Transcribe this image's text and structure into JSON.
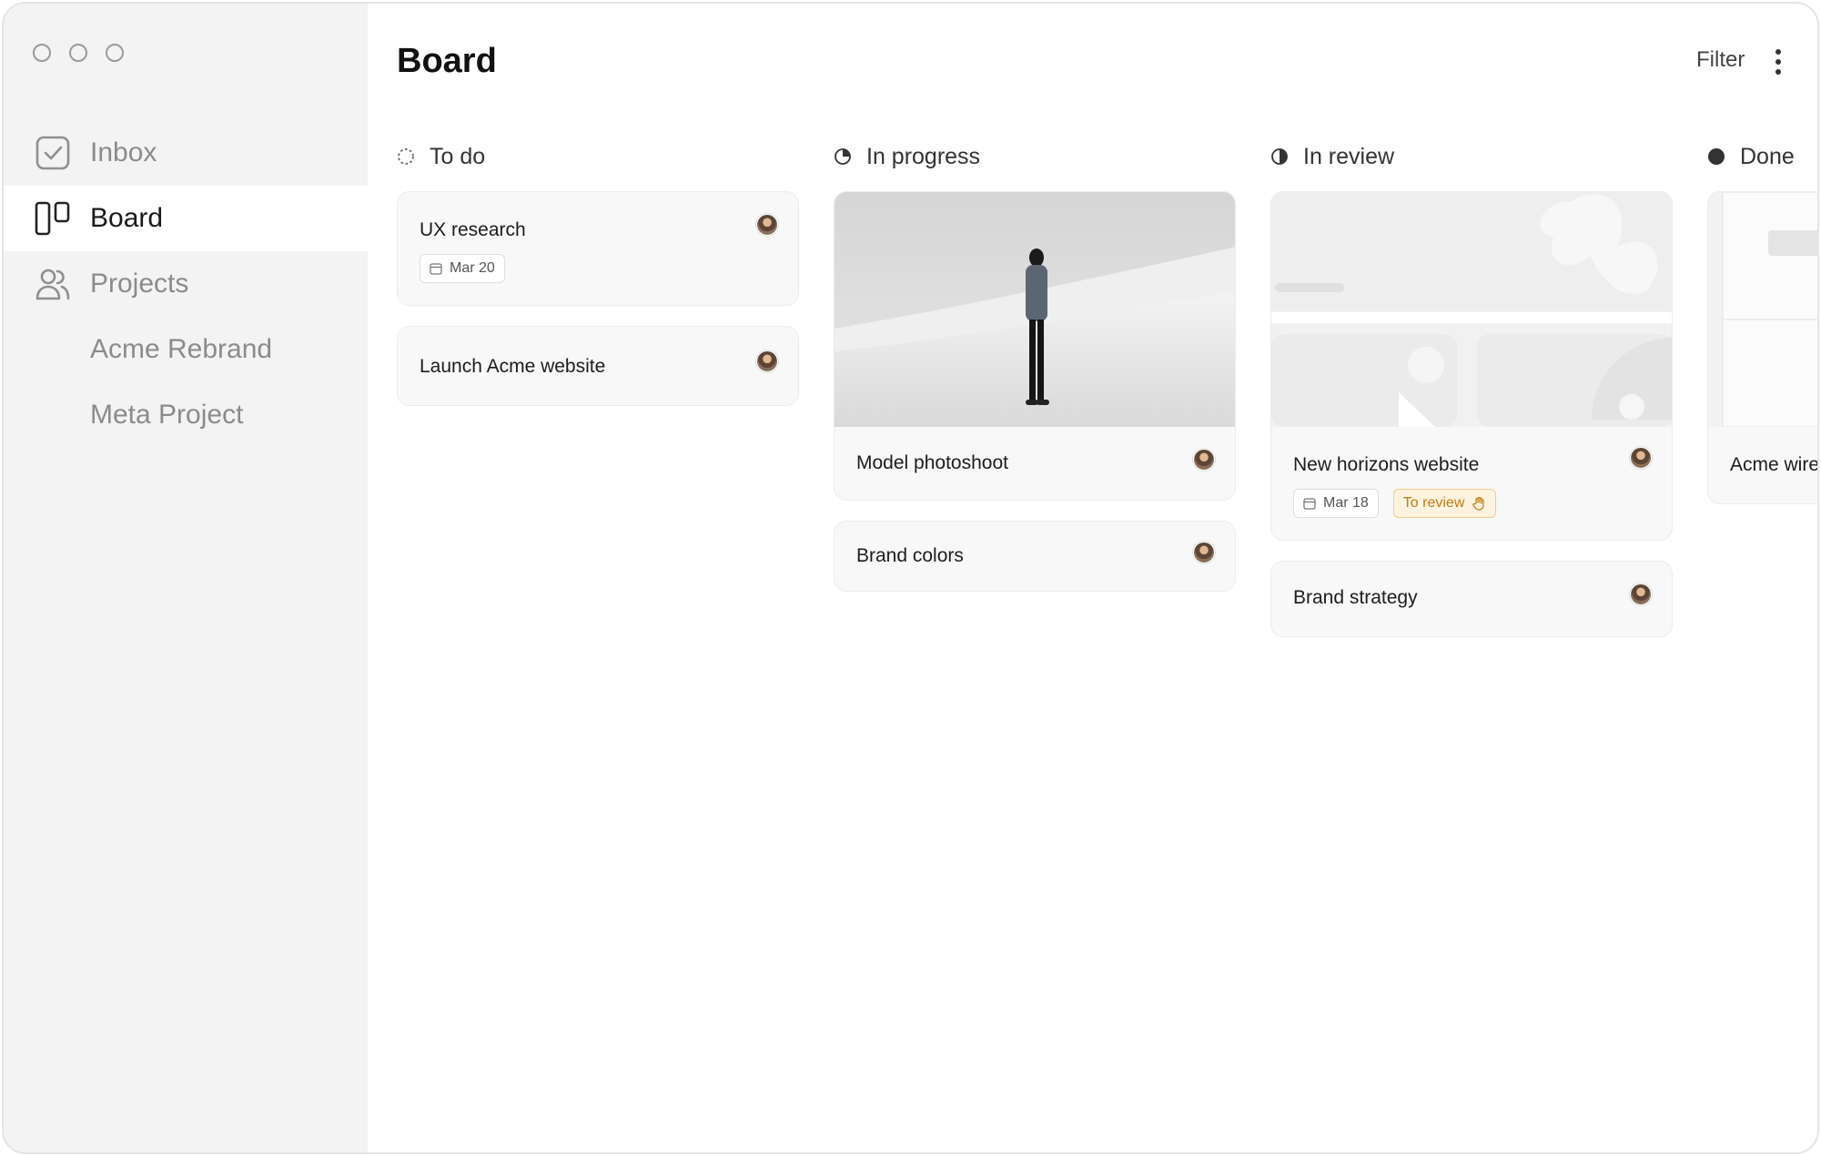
{
  "sidebar": {
    "items": [
      {
        "label": "Inbox",
        "icon": "inbox-check-icon"
      },
      {
        "label": "Board",
        "icon": "board-columns-icon"
      },
      {
        "label": "Projects",
        "icon": "people-icon"
      }
    ],
    "projects": [
      "Acme Rebrand",
      "Meta Project"
    ]
  },
  "header": {
    "title": "Board",
    "filter_label": "Filter",
    "more_icon": "more-vertical-icon"
  },
  "columns": [
    {
      "title": "To do",
      "cards": [
        {
          "title": "UX research",
          "date": "Mar 20"
        },
        {
          "title": "Launch Acme website"
        }
      ]
    },
    {
      "title": "In progress",
      "cards": [
        {
          "title": "Model photoshoot"
        },
        {
          "title": "Brand colors"
        }
      ]
    },
    {
      "title": "In review",
      "cards": [
        {
          "title": "New horizons website",
          "date": "Mar 18",
          "badge": "To review"
        },
        {
          "title": "Brand strategy"
        }
      ]
    },
    {
      "title": "Done",
      "cards": [
        {
          "title": "Acme wiref"
        }
      ]
    }
  ],
  "colors": {
    "sidebar_bg": "#f3f3f3",
    "active_bg": "#ffffff",
    "review_badge_bg": "#fff3df",
    "review_badge_text": "#c47a12"
  }
}
